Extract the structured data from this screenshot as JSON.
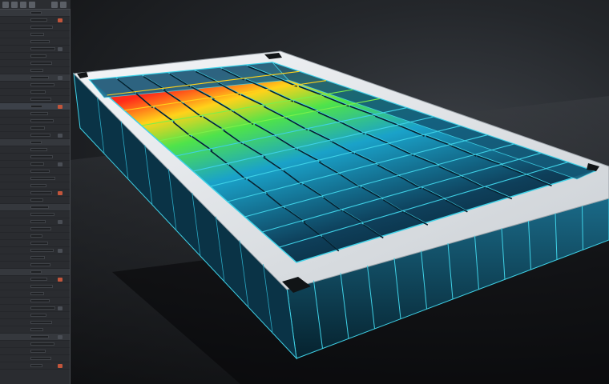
{
  "app": {
    "accent_color": "#d36c3f",
    "panel_color": "#2a2c30"
  },
  "toolbar": {
    "icons": [
      "file-icon",
      "save-icon",
      "undo-icon",
      "redo-icon",
      "select-icon",
      "move-icon",
      "render-icon",
      "settings-icon"
    ]
  },
  "viewport": {
    "model": "mold-tray-simulation",
    "render_mode": "thermal-heatmap",
    "colors": {
      "frame": "#e8ebee",
      "wall": "#0f4a63",
      "cell_edge": "#3fd1e6",
      "hot": "#ff2a1a",
      "warm": "#ffd21a",
      "mid": "#4fe34a",
      "cool": "#1a8cff"
    }
  }
}
